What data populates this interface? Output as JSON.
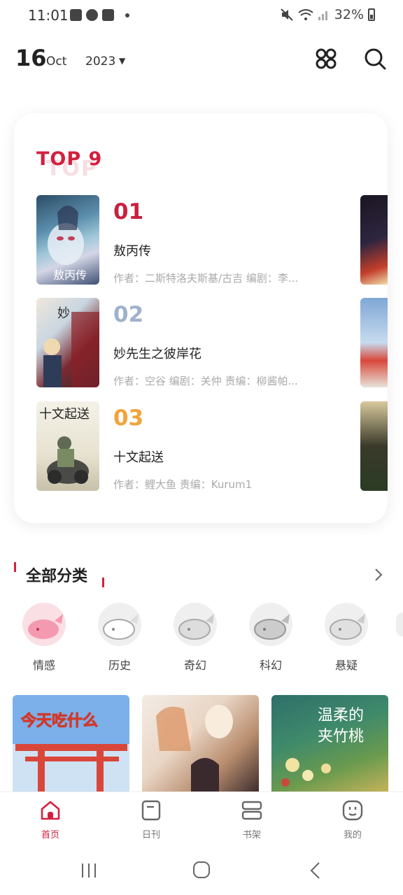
{
  "status_bar": {
    "time": "11:01",
    "battery": "32%"
  },
  "header": {
    "day": "16",
    "month": "Oct",
    "year": "2023"
  },
  "top_list": {
    "title": "TOP 9",
    "items": [
      {
        "rank": "01",
        "rank_color": "#c8213f",
        "name": "敖丙传",
        "authors": "作者：二斯特洛夫斯基/古吉  编剧：李..."
      },
      {
        "rank": "02",
        "rank_color": "#9fb2cc",
        "name": "妙先生之彼岸花",
        "authors": "作者：空谷  编剧：关仲  责编：柳酱帕..."
      },
      {
        "rank": "03",
        "rank_color": "#f2a33a",
        "name": "十文起送",
        "authors": "作者：鲤大鱼 责编：Kurum1"
      }
    ]
  },
  "categories": {
    "title": "全部分类",
    "items": [
      {
        "label": "情感",
        "active": true
      },
      {
        "label": "历史",
        "active": false
      },
      {
        "label": "奇幻",
        "active": false
      },
      {
        "label": "科幻",
        "active": false
      },
      {
        "label": "悬疑",
        "active": false
      }
    ]
  },
  "recommend": [
    {
      "cover_text": "今天吃什么"
    },
    {
      "cover_text": ""
    },
    {
      "cover_text": "温柔的 夹竹桃"
    }
  ],
  "bottom_nav": [
    {
      "label": "首页",
      "icon": "home-icon",
      "active": true
    },
    {
      "label": "日刊",
      "icon": "daily-icon",
      "active": false
    },
    {
      "label": "书架",
      "icon": "bookshelf-icon",
      "active": false
    },
    {
      "label": "我的",
      "icon": "profile-icon",
      "active": false
    }
  ],
  "colors": {
    "accent": "#d3203f"
  }
}
